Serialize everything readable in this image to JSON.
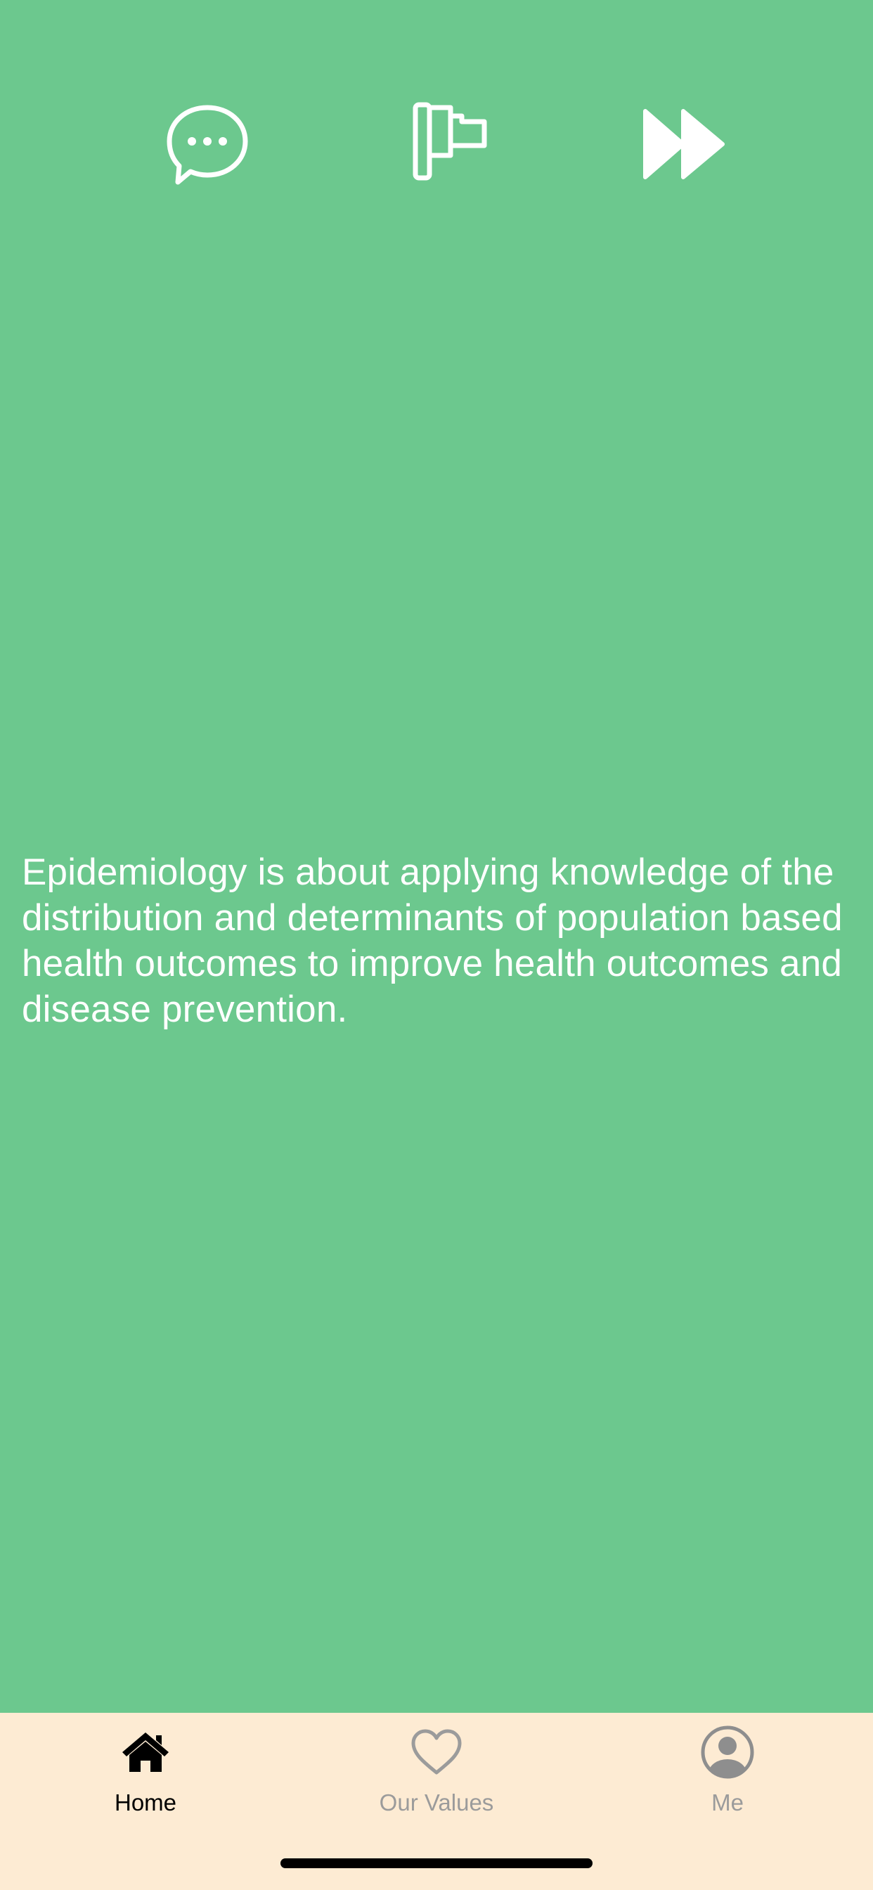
{
  "screen": {
    "background_color": "#6cc88e",
    "quote_text": "Epidemiology is about applying knowledge of the distribution and determinants of population based health outcomes to improve health outcomes and disease prevention."
  },
  "top_actions": [
    {
      "icon": "chat-bubble-icon"
    },
    {
      "icon": "flag-icon"
    },
    {
      "icon": "fast-forward-icon"
    }
  ],
  "tabbar": {
    "background_color": "#fdebd3",
    "active_color": "#000000",
    "inactive_color": "#9b9b9b",
    "tabs": [
      {
        "label": "Home",
        "icon": "home-icon",
        "active": true
      },
      {
        "label": "Our Values",
        "icon": "heart-icon",
        "active": false
      },
      {
        "label": "Me",
        "icon": "profile-icon",
        "active": false
      }
    ]
  }
}
